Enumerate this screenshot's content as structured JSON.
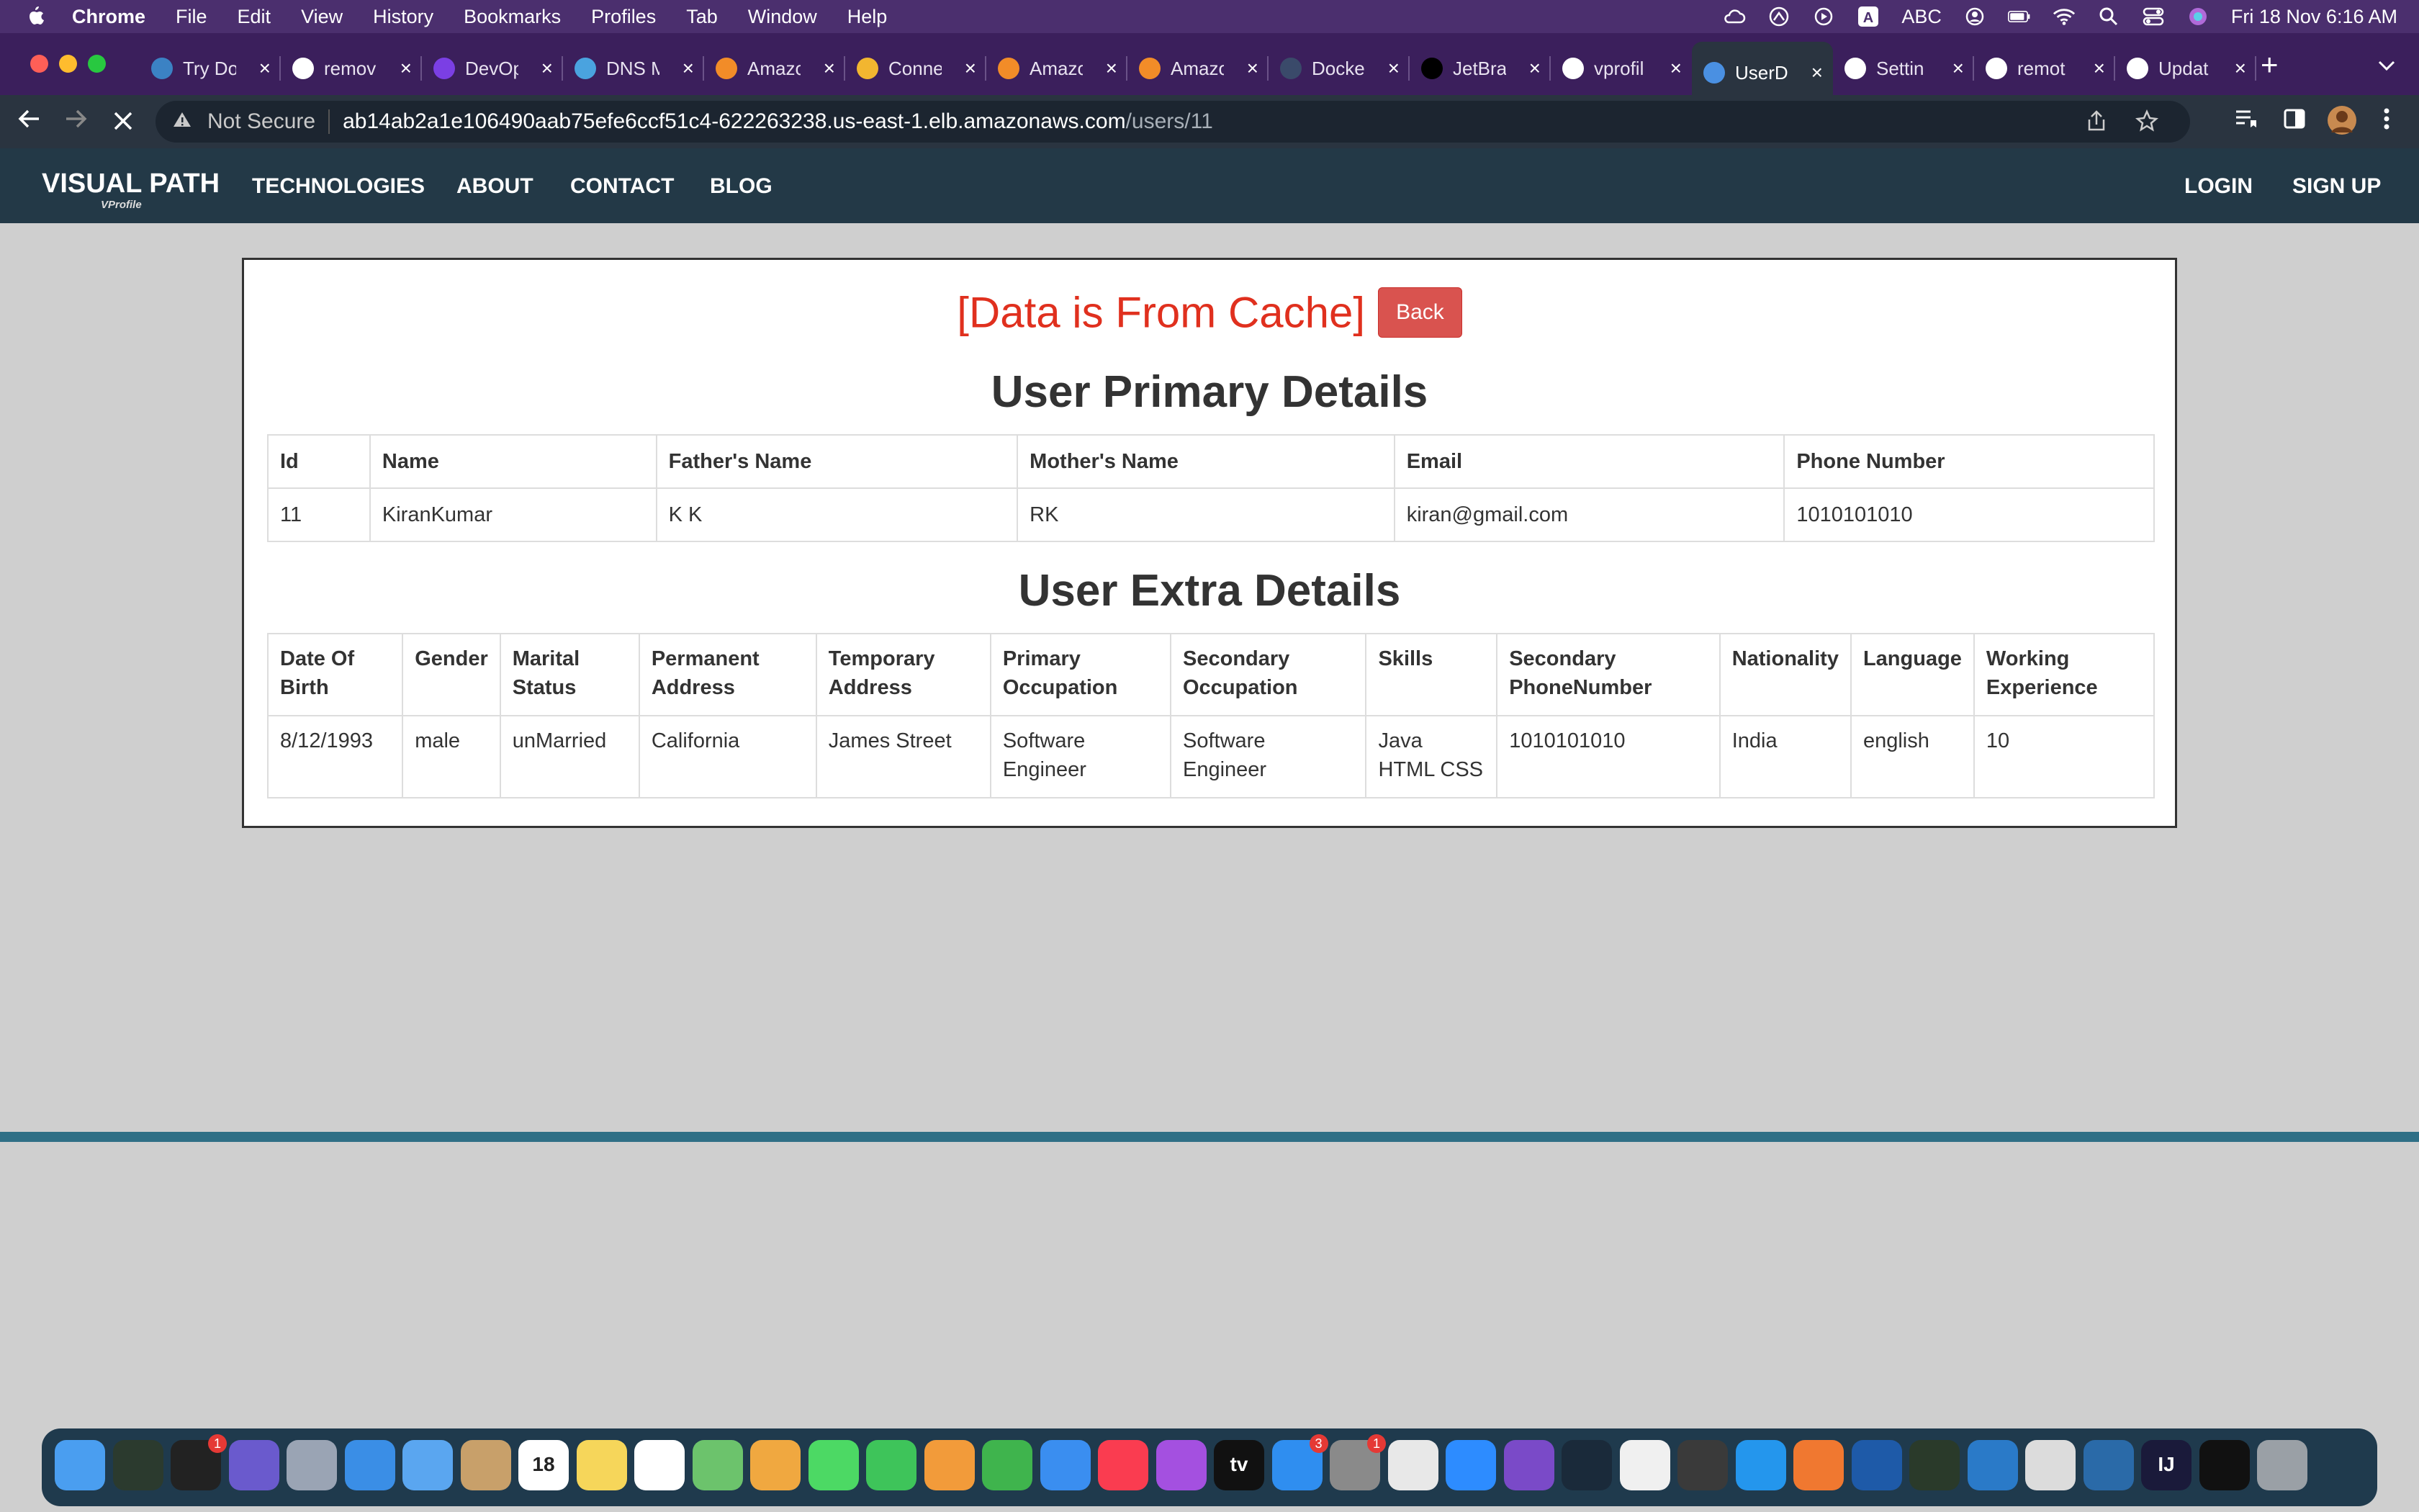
{
  "menubar": {
    "app_name": "Chrome",
    "items": [
      "File",
      "Edit",
      "View",
      "History",
      "Bookmarks",
      "Profiles",
      "Tab",
      "Window",
      "Help"
    ],
    "input_source": "ABC",
    "datetime": "Fri 18 Nov  6:16 AM"
  },
  "browser": {
    "tabs": [
      {
        "title": "Try Do",
        "favicon": "globe-icon",
        "color": "#3b82c4"
      },
      {
        "title": "remov",
        "favicon": "google-icon",
        "color": "#ffffff"
      },
      {
        "title": "DevOp",
        "favicon": "devops-icon",
        "color": "#7b3fe4"
      },
      {
        "title": "DNS M",
        "favicon": "dns-icon",
        "color": "#4aa3df"
      },
      {
        "title": "Amazo",
        "favicon": "aws-icon",
        "color": "#f28c28"
      },
      {
        "title": "Conne",
        "favicon": "box-icon",
        "color": "#f2b630"
      },
      {
        "title": "Amazo",
        "favicon": "aws-icon",
        "color": "#f28c28"
      },
      {
        "title": "Amazo",
        "favicon": "aws-icon",
        "color": "#f28c28"
      },
      {
        "title": "Docke",
        "favicon": "docker-icon",
        "color": "#3a4a6a"
      },
      {
        "title": "JetBra",
        "favicon": "jetbrains-icon",
        "color": "#000000"
      },
      {
        "title": "vprofil",
        "favicon": "github-icon",
        "color": "#ffffff"
      },
      {
        "title": "UserD",
        "favicon": "loading-icon",
        "color": "#4a90e2"
      },
      {
        "title": "Settin",
        "favicon": "gear-icon",
        "color": "#ffffff"
      },
      {
        "title": "remot",
        "favicon": "google-icon",
        "color": "#ffffff"
      },
      {
        "title": "Updat",
        "favicon": "github-icon",
        "color": "#ffffff"
      }
    ],
    "active_tab_index": 11,
    "security_label": "Not Secure",
    "url_host": "ab14ab2a1e106490aab75efe6ccf51c4-622263238.us-east-1.elb.amazonaws.com",
    "url_path": "/users/11"
  },
  "site": {
    "brand": "VISUAL PATH",
    "brand_sub": "VProfile",
    "nav_left": [
      "TECHNOLOGIES",
      "ABOUT",
      "CONTACT",
      "BLOG"
    ],
    "nav_right": [
      "LOGIN",
      "SIGN UP"
    ]
  },
  "page": {
    "cache_message": "[Data is From Cache]",
    "back_label": "Back",
    "primary_title": "User Primary Details",
    "primary_headers": [
      "Id",
      "Name",
      "Father's Name",
      "Mother's Name",
      "Email",
      "Phone Number"
    ],
    "primary_row": [
      "11",
      "KiranKumar",
      "K K",
      "RK",
      "kiran@gmail.com",
      "1010101010"
    ],
    "extra_title": "User Extra Details",
    "extra_headers": [
      "Date Of Birth",
      "Gender",
      "Marital Status",
      "Permanent Address",
      "Temporary Address",
      "Primary Occupation",
      "Secondary Occupation",
      "Skills",
      "Secondary PhoneNumber",
      "Nationality",
      "Language",
      "Working Experience"
    ],
    "extra_row": [
      "8/12/1993",
      "male",
      "unMarried",
      "California",
      "James Street",
      "Software Engineer",
      "Software Engineer",
      "Java HTML CSS",
      "1010101010",
      "India",
      "english",
      "10"
    ]
  },
  "dock": {
    "apps": [
      {
        "name": "finder-icon",
        "color": "#4a9ef0"
      },
      {
        "name": "activity-monitor-icon",
        "color": "#2b3a2e"
      },
      {
        "name": "terminal-icon",
        "color": "#222222",
        "badge": "1"
      },
      {
        "name": "siri-icon",
        "color": "#6a5acd"
      },
      {
        "name": "launchpad-icon",
        "color": "#9aa4b4"
      },
      {
        "name": "safari-icon",
        "color": "#3a8ee6"
      },
      {
        "name": "mail-icon",
        "color": "#5aa6f0"
      },
      {
        "name": "contacts-icon",
        "color": "#c8a06a"
      },
      {
        "name": "calendar-icon",
        "color": "#ffffff",
        "label": "18"
      },
      {
        "name": "notes-icon",
        "color": "#f6d65a"
      },
      {
        "name": "reminders-icon",
        "color": "#ffffff"
      },
      {
        "name": "maps-icon",
        "color": "#6cc36c"
      },
      {
        "name": "photos-icon",
        "color": "#f0a840"
      },
      {
        "name": "messages-icon",
        "color": "#4cd964"
      },
      {
        "name": "facetime-icon",
        "color": "#3ec45a"
      },
      {
        "name": "pages-icon",
        "color": "#f29b3a"
      },
      {
        "name": "numbers-icon",
        "color": "#3fb44d"
      },
      {
        "name": "keynote-icon",
        "color": "#3a8ef0"
      },
      {
        "name": "music-icon",
        "color": "#fa3c50"
      },
      {
        "name": "podcasts-icon",
        "color": "#a450e0"
      },
      {
        "name": "tv-icon",
        "color": "#111111",
        "label": "tv"
      },
      {
        "name": "app-store-icon",
        "color": "#2f8ef0",
        "badge": "3"
      },
      {
        "name": "system-preferences-icon",
        "color": "#8a8a8a",
        "badge": "1"
      },
      {
        "name": "chrome-icon",
        "color": "#e8e8e8"
      },
      {
        "name": "zoom-icon",
        "color": "#2d8cff"
      },
      {
        "name": "github-desktop-icon",
        "color": "#7a4ac8"
      },
      {
        "name": "beta-app-icon",
        "color": "#1a2a3a"
      },
      {
        "name": "screen-tool-icon",
        "color": "#f0f0f0"
      },
      {
        "name": "postman-icon",
        "color": "#3a3a3a"
      },
      {
        "name": "docker-icon",
        "color": "#2496ed"
      },
      {
        "name": "pen-tool-icon",
        "color": "#f07830"
      },
      {
        "name": "virtualbox-icon",
        "color": "#1e5aa8"
      },
      {
        "name": "progress-icon",
        "color": "#2a3a2a"
      },
      {
        "name": "vscode-icon",
        "color": "#2a7ac8"
      },
      {
        "name": "mountain-app-icon",
        "color": "#dcdcdc"
      },
      {
        "name": "xcode-tool-icon",
        "color": "#2a6aa8"
      },
      {
        "name": "intellij-icon",
        "color": "#1a1a3a",
        "label": "IJ"
      },
      {
        "name": "screen-icon",
        "color": "#111111"
      },
      {
        "name": "trash-icon",
        "color": "#9aa0a6"
      }
    ]
  }
}
